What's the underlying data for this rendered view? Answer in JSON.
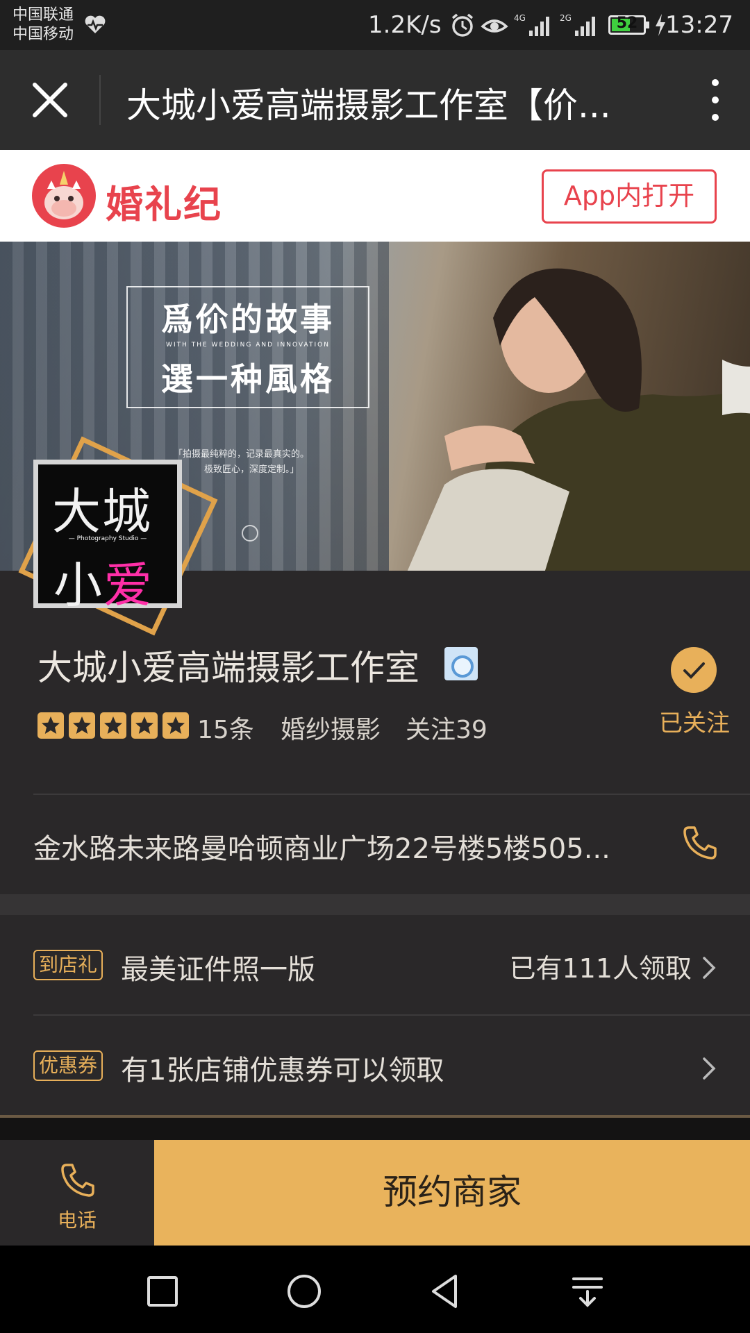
{
  "status_bar": {
    "carrier1": "中国联通",
    "carrier2": "中国移动",
    "net_speed": "1.2K/s",
    "battery": "52",
    "time": "13:27",
    "icons": [
      "heart-pulse-icon",
      "alarm-icon",
      "eye-icon",
      "signal-4g-icon",
      "signal-2g-icon",
      "battery-icon",
      "charging-icon"
    ]
  },
  "titlebar": {
    "title": "大城小爱高端摄影工作室【价...",
    "close_icon": "close-icon",
    "more_icon": "more-vertical-icon"
  },
  "app_banner": {
    "logo_text": "婚礼纪",
    "open_button": "App内打开",
    "brand_color": "#e8434d"
  },
  "hero": {
    "line1": "爲伱的故事",
    "subline": "WITH THE WEDDING AND INNOVATION",
    "line2": "選一种風格",
    "caption1": "「拍摄最纯粹的，记录最真实的。",
    "caption2": "极致匠心，深度定制。」"
  },
  "shop_logo": {
    "line1": "大城",
    "studio": "— Photography Studio —",
    "line2a": "小",
    "line2b": "爱"
  },
  "shop": {
    "name": "大城小爱高端摄影工作室",
    "rating": 5,
    "reviews": "15条",
    "category": "婚纱摄影",
    "followers": "关注39",
    "follow_status": "已关注",
    "address": "金水路未来路曼哈顿商业广场22号楼5楼505...",
    "accent_color": "#e8b05a"
  },
  "offers": [
    {
      "tag": "到店礼",
      "text": "最美证件照一版",
      "right": "已有111人领取"
    },
    {
      "tag": "优惠券",
      "text": "有1张店铺优惠券可以领取",
      "right": ""
    }
  ],
  "action_bar": {
    "call_label": "电话",
    "book_label": "预约商家"
  },
  "nav": [
    "recents-square-icon",
    "home-circle-icon",
    "back-triangle-icon",
    "notification-pulldown-icon"
  ]
}
